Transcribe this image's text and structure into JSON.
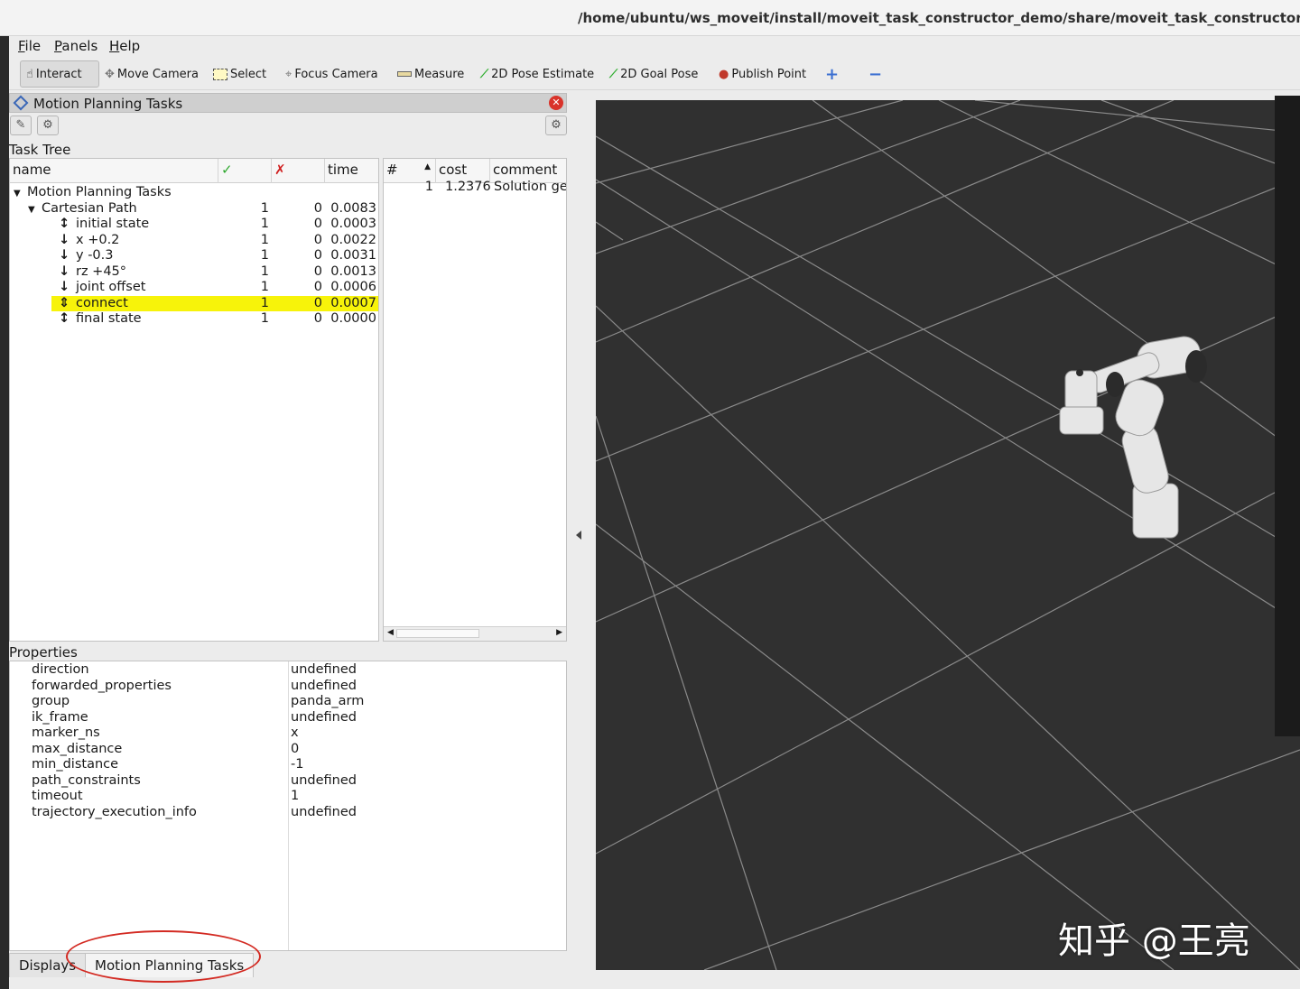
{
  "window": {
    "title": "/home/ubuntu/ws_moveit/install/moveit_task_constructor_demo/share/moveit_task_constructor_demo/conf"
  },
  "menu": [
    "File",
    "Panels",
    "Help"
  ],
  "toolbar": {
    "tools": [
      {
        "label": "Interact",
        "icon": "hand-icon",
        "active": true
      },
      {
        "label": "Move Camera",
        "icon": "move-camera-icon"
      },
      {
        "label": "Select",
        "icon": "select-icon"
      },
      {
        "label": "Focus Camera",
        "icon": "focus-camera-icon"
      },
      {
        "label": "Measure",
        "icon": "ruler-icon"
      },
      {
        "label": "2D Pose Estimate",
        "icon": "green-arrow-icon"
      },
      {
        "label": "2D Goal Pose",
        "icon": "green-arrow-icon"
      },
      {
        "label": "Publish Point",
        "icon": "pin-icon"
      }
    ]
  },
  "panel": {
    "title": "Motion Planning Tasks",
    "task_tree_label": "Task Tree",
    "columns": {
      "name": "name",
      "success": "✓",
      "failure": "✗",
      "time": "time"
    },
    "rows": [
      {
        "name": "Motion Planning Tasks",
        "ok": "",
        "fail": "",
        "time": "",
        "icon": "expand-arrow-icon"
      },
      {
        "name": "Cartesian Path",
        "ok": "1",
        "fail": "0",
        "time": "0.0083",
        "icon": "expand-arrow-icon"
      },
      {
        "name": "initial state",
        "ok": "1",
        "fail": "0",
        "time": "0.0003",
        "icon": "bidirectional-arrow-icon"
      },
      {
        "name": "x +0.2",
        "ok": "1",
        "fail": "0",
        "time": "0.0022",
        "icon": "down-arrow-icon"
      },
      {
        "name": "y -0.3",
        "ok": "1",
        "fail": "0",
        "time": "0.0031",
        "icon": "down-arrow-icon"
      },
      {
        "name": "rz +45°",
        "ok": "1",
        "fail": "0",
        "time": "0.0013",
        "icon": "down-arrow-icon"
      },
      {
        "name": "joint offset",
        "ok": "1",
        "fail": "0",
        "time": "0.0006",
        "icon": "down-arrow-icon"
      },
      {
        "name": "connect",
        "ok": "1",
        "fail": "0",
        "time": "0.0007",
        "icon": "connect-icon",
        "selected": true
      },
      {
        "name": "final state",
        "ok": "1",
        "fail": "0",
        "time": "0.0000",
        "icon": "bidirectional-arrow-icon"
      }
    ],
    "solutions": {
      "columns": {
        "index": "#",
        "cost": "cost",
        "comment": "comment"
      },
      "rows": [
        {
          "index": "1",
          "cost": "1.2376",
          "comment": "Solution ge"
        }
      ]
    },
    "properties_label": "Properties",
    "properties": [
      {
        "key": "direction",
        "value": "undefined"
      },
      {
        "key": "forwarded_properties",
        "value": "undefined"
      },
      {
        "key": "group",
        "value": "panda_arm"
      },
      {
        "key": "ik_frame",
        "value": "undefined"
      },
      {
        "key": "marker_ns",
        "value": "x"
      },
      {
        "key": "max_distance",
        "value": "0"
      },
      {
        "key": "min_distance",
        "value": "-1"
      },
      {
        "key": "path_constraints",
        "value": "undefined"
      },
      {
        "key": "timeout",
        "value": "1"
      },
      {
        "key": "trajectory_execution_info",
        "value": "undefined"
      }
    ]
  },
  "tabs": [
    "Displays",
    "Motion Planning Tasks"
  ],
  "watermark": "知乎 @王亮",
  "colors": {
    "highlight": "#f7f30a",
    "viewport_bg": "#303030",
    "annotation": "#d32a22"
  }
}
